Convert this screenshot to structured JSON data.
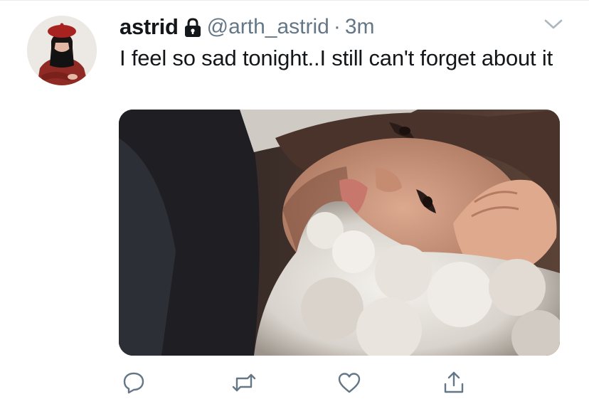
{
  "tweet": {
    "display_name": "astrid",
    "handle": "@arth_astrid",
    "separator": "·",
    "time": "3m",
    "text": "I feel so sad tonight..I still can't forget about it",
    "icons": {
      "avatar": "avatar-photo",
      "protected": "lock-icon",
      "menu": "chevron-down-icon",
      "media": "photo"
    },
    "actions": [
      {
        "name": "reply",
        "icon": "reply-icon"
      },
      {
        "name": "retweet",
        "icon": "retweet-icon"
      },
      {
        "name": "like",
        "icon": "heart-icon"
      },
      {
        "name": "share",
        "icon": "share-icon"
      }
    ]
  },
  "colors": {
    "primary_text": "#14171a",
    "secondary_text": "#657786",
    "icon_gray": "#657786",
    "divider": "#e6ecf0"
  }
}
